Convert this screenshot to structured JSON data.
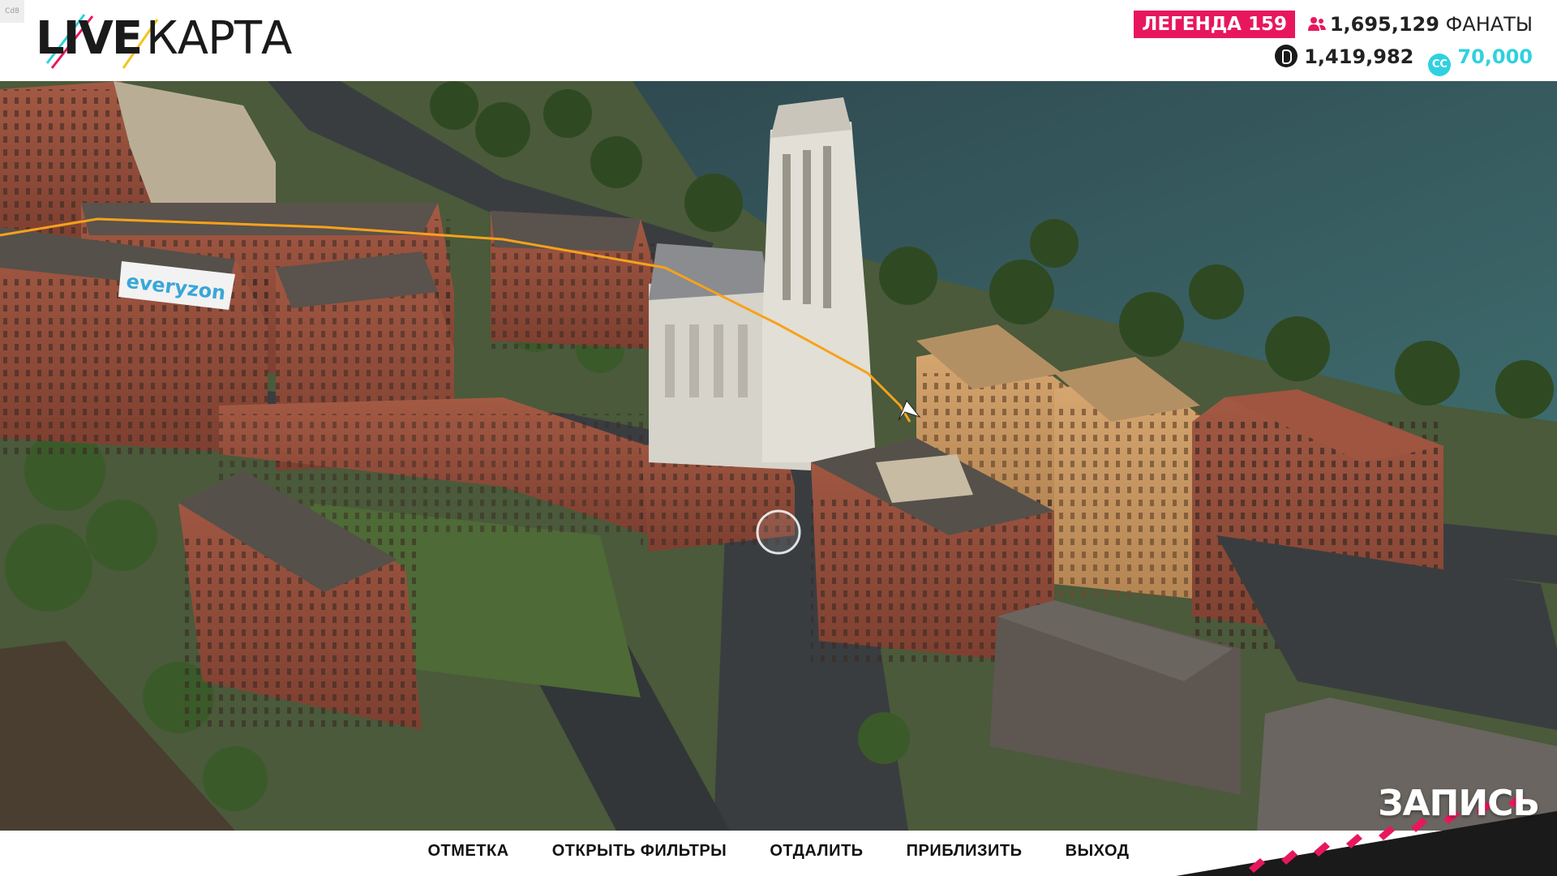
{
  "corner_tag": "Cd8",
  "logo": {
    "part1": "LIVE",
    "part2": "КАРТА"
  },
  "stats": {
    "legend": "ЛЕГЕНДА 159",
    "fans_value": "1,695,129",
    "fans_label": "ФАНАТЫ",
    "bucks": "1,419,982",
    "cc_icon": "CC",
    "crew_credits": "70,000"
  },
  "map": {
    "billboard": "everyzon",
    "player_icon": "player-arrow-icon",
    "cursor_icon": "map-cursor-icon"
  },
  "menu": [
    "ОТМЕТКА",
    "ОТКРЫТЬ ФИЛЬТРЫ",
    "ОТДАЛИТЬ",
    "ПРИБЛИЗИТЬ",
    "ВЫХОД"
  ],
  "recording": "ЗАПИСЬ",
  "colors": {
    "accent_pink": "#e8175d",
    "cc_cyan": "#2fd1e0",
    "route": "#f7a21b"
  }
}
